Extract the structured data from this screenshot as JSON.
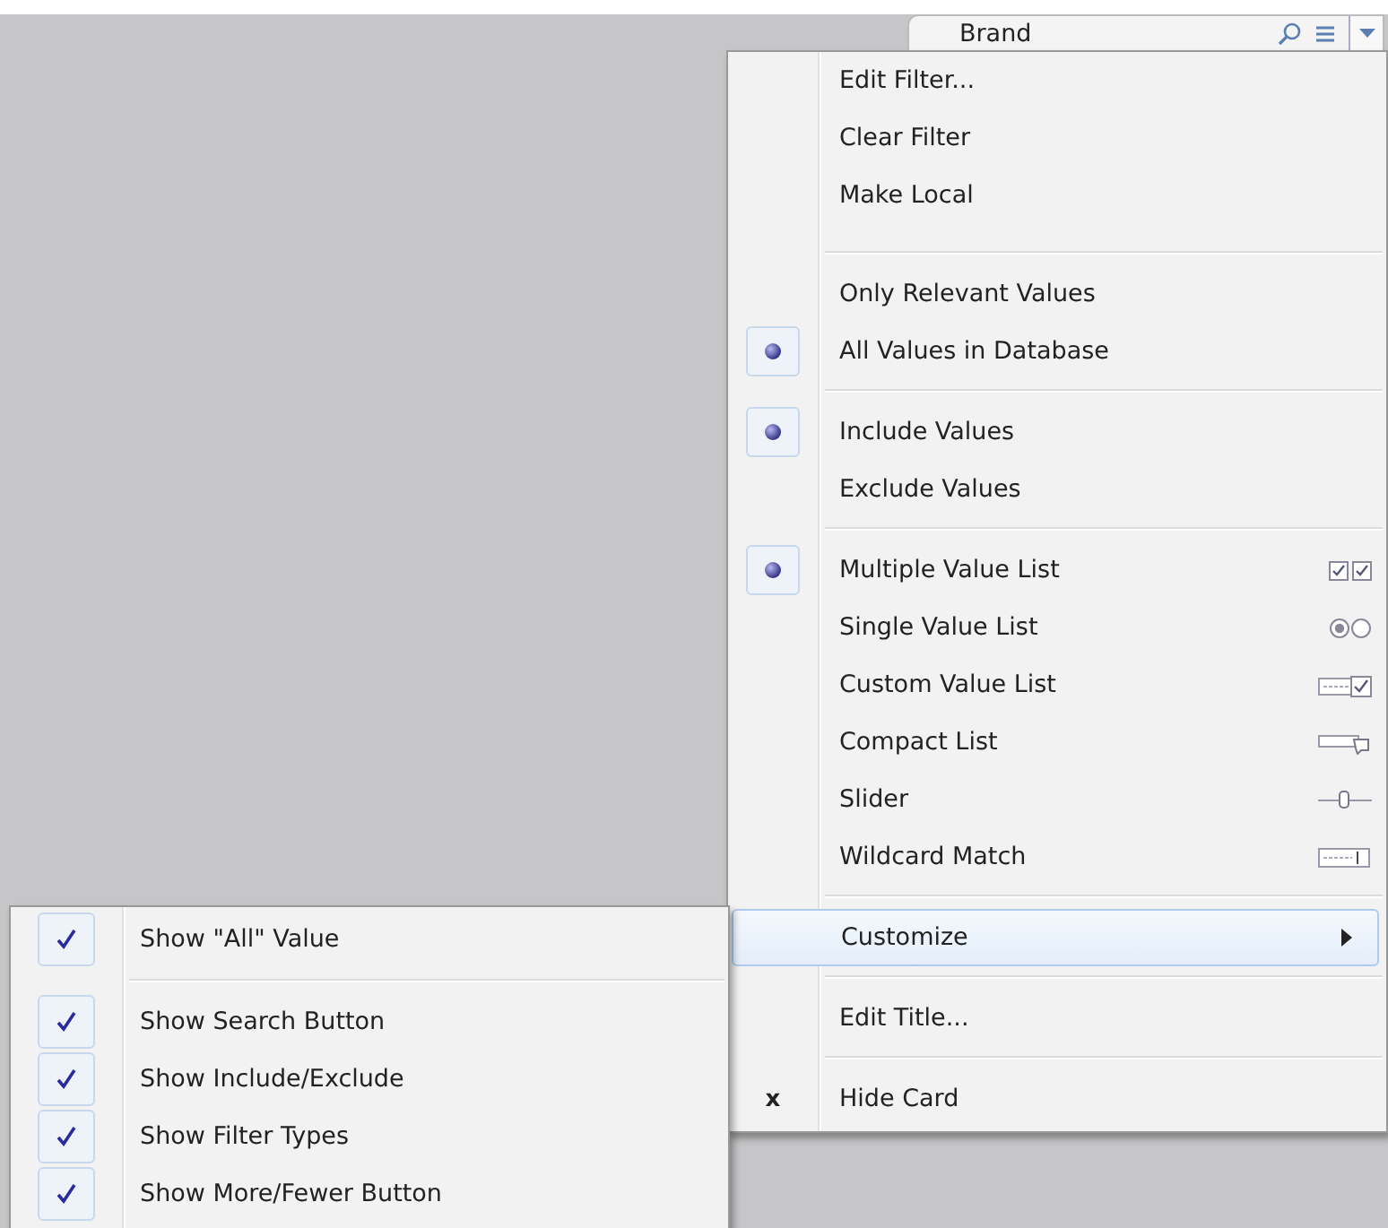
{
  "card": {
    "title": "Brand"
  },
  "menu": {
    "groups": [
      [
        {
          "label": "Edit Filter...",
          "kind": "plain"
        },
        {
          "label": "Clear Filter",
          "kind": "plain"
        },
        {
          "label": "Make Local",
          "kind": "plain"
        }
      ],
      [
        {
          "label": "Only Relevant Values",
          "kind": "radio",
          "selected": false
        },
        {
          "label": "All Values in Database",
          "kind": "radio",
          "selected": true
        }
      ],
      [
        {
          "label": "Include Values",
          "kind": "radio",
          "selected": true
        },
        {
          "label": "Exclude Values",
          "kind": "radio",
          "selected": false
        }
      ],
      [
        {
          "label": "Multiple Value List",
          "kind": "multiple",
          "selected": true
        },
        {
          "label": "Single Value List",
          "kind": "single",
          "selected": false
        },
        {
          "label": "Custom Value List",
          "kind": "custom",
          "selected": false
        },
        {
          "label": "Compact List",
          "kind": "compact",
          "selected": false
        },
        {
          "label": "Slider",
          "kind": "slider",
          "selected": false
        },
        {
          "label": "Wildcard Match",
          "kind": "wildcard",
          "selected": false
        }
      ],
      [
        {
          "label": "Customize",
          "kind": "submenu",
          "expanded": true
        }
      ],
      [
        {
          "label": "Edit Title...",
          "kind": "plain"
        }
      ],
      [
        {
          "label": "Hide Card",
          "kind": "marked",
          "mark": "x"
        }
      ]
    ]
  },
  "submenu": {
    "groups": [
      [
        {
          "label": "Show \"All\" Value",
          "checked": true
        }
      ],
      [
        {
          "label": "Show Search Button",
          "checked": true
        },
        {
          "label": "Show Include/Exclude",
          "checked": true
        },
        {
          "label": "Show Filter Types",
          "checked": true
        },
        {
          "label": "Show More/Fewer Button",
          "checked": true
        }
      ]
    ]
  }
}
